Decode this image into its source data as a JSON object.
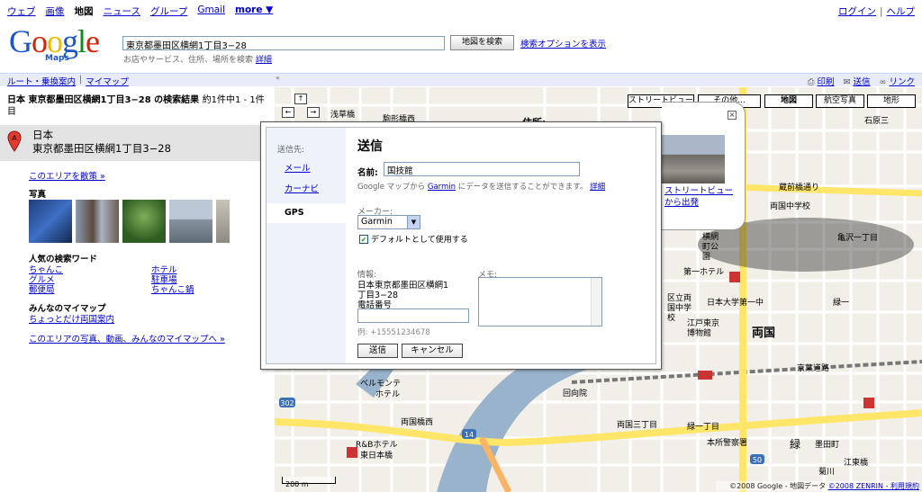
{
  "topnav": {
    "links": [
      "ウェブ",
      "画像",
      "地図",
      "ニュース",
      "グループ",
      "Gmail",
      "more ▼"
    ],
    "active": "地図",
    "login": "ログイン",
    "help": "ヘルプ",
    "sep": "|"
  },
  "header": {
    "logo_text": "Google",
    "logo_sub": "Maps",
    "search_value": "東京都墨田区横網1丁目3−28",
    "search_button": "地図を検索",
    "advanced_link": "検索オプションを表示",
    "hint_text": "お店やサービス、住所、場所を検索",
    "hint_link": "詳細"
  },
  "subbar": {
    "route": "ルート・乗換案内",
    "mymaps": "マイマップ",
    "sep": "|",
    "collapse": "«",
    "print": "印刷",
    "send": "送信",
    "link": "リンク"
  },
  "left": {
    "result_title": "日本 東京都墨田区横網1丁目3−28 の検索結果",
    "result_count": "約1件中1 - 1件目",
    "pin_label": "A",
    "addr1": "日本",
    "addr2": "東京都墨田区横網1丁目3−28",
    "area_info": "このエリアを散策 »",
    "photo_label": "写真",
    "popular_label": "人気の検索ワード",
    "keywords": [
      "ちゃんこ",
      "ホテル",
      "グルメ",
      "駐車場",
      "郵便局",
      "ちゃんこ鍋"
    ],
    "mymaps_label": "みんなのマイマップ",
    "mymaps_link": "ちょっとだけ両国案内",
    "area_photos": "このエリアの写真、動画、みんなのマイマップへ »"
  },
  "map": {
    "buttons": [
      "ストリートビュー",
      "その他...",
      "地図",
      "航空写真",
      "地形"
    ],
    "nav_arrows": [
      "↑",
      "←",
      "→",
      "↓"
    ],
    "scale": "200 m",
    "copyright": "©2008 ZENRIN - 利用規約",
    "copyright_prefix": "©2008 Google - 地図データ",
    "labels": [
      {
        "t": "浅草橋",
        "c": "#000"
      },
      {
        "t": "ベルモンテ",
        "c": "#000"
      },
      {
        "t": "ホテル",
        "c": "#000"
      },
      {
        "t": "両国橋西",
        "c": "#000"
      },
      {
        "t": "R&Bホテル",
        "c": "#000"
      },
      {
        "t": "東日本橋",
        "c": "#000"
      },
      {
        "t": "両国",
        "c": "#000"
      },
      {
        "t": "回向院",
        "c": "#000"
      },
      {
        "t": "両国三丁目",
        "c": "#000"
      },
      {
        "t": "緑一丁目",
        "c": "#000"
      },
      {
        "t": "本所警察署",
        "c": "#000"
      },
      {
        "t": "緑",
        "c": "#000"
      },
      {
        "t": "墨田町",
        "c": "#000"
      },
      {
        "t": "江東橋",
        "c": "#000"
      },
      {
        "t": "菊川",
        "c": "#000"
      },
      {
        "t": "両国中学校",
        "c": "#000"
      },
      {
        "t": "亀沢一丁目",
        "c": "#000"
      },
      {
        "t": "石原三",
        "c": "#000"
      },
      {
        "t": "日本大学第一中",
        "c": "#000"
      },
      {
        "t": "第一ホテル",
        "c": "#000"
      },
      {
        "t": "区立両国中学校",
        "c": "#000"
      },
      {
        "t": "江戸東京博物館",
        "c": "#000"
      },
      {
        "t": "緑一",
        "c": "#000"
      },
      {
        "t": "横網町公園",
        "c": "#000"
      },
      {
        "t": "蔵前橋通り",
        "c": "#000"
      },
      {
        "t": "京葉道路",
        "c": "#000"
      },
      {
        "t": "駒形橋西",
        "c": "#000"
      }
    ],
    "route_shields": [
      "14",
      "50",
      "302"
    ]
  },
  "infow": {
    "title": "住所:",
    "sv_link1": "ストリートビュー",
    "sv_link2": "から出発"
  },
  "modal": {
    "title": "送信",
    "side_label": "送信先:",
    "side_items": [
      "メール",
      "カーナビ",
      "GPS"
    ],
    "selected": "GPS",
    "name_label": "名前:",
    "name_value": "国技館",
    "note_prefix": "Google マップから",
    "note_link": "Garmin",
    "note_suffix": "にデータを送信することができます。",
    "note_detail": "詳細",
    "maker_label": "メーカー:",
    "maker_value": "Garmin",
    "default_label": "デフォルトとして使用する",
    "info_label": "情報:",
    "info_lines": [
      "日本東京都墨田区横網1",
      "丁目3−28",
      "電話番号"
    ],
    "example": "例: +15551234678",
    "memo_label": "メモ:",
    "send_button": "送信",
    "cancel_button": "キャンセル"
  },
  "colors": {
    "link": "#0000cc",
    "bar_bg": "#e8ecf9",
    "map_bg": "#f2efe9",
    "road_yellow": "#ffe568",
    "water": "#99b3cc",
    "station": "#cc3333"
  }
}
